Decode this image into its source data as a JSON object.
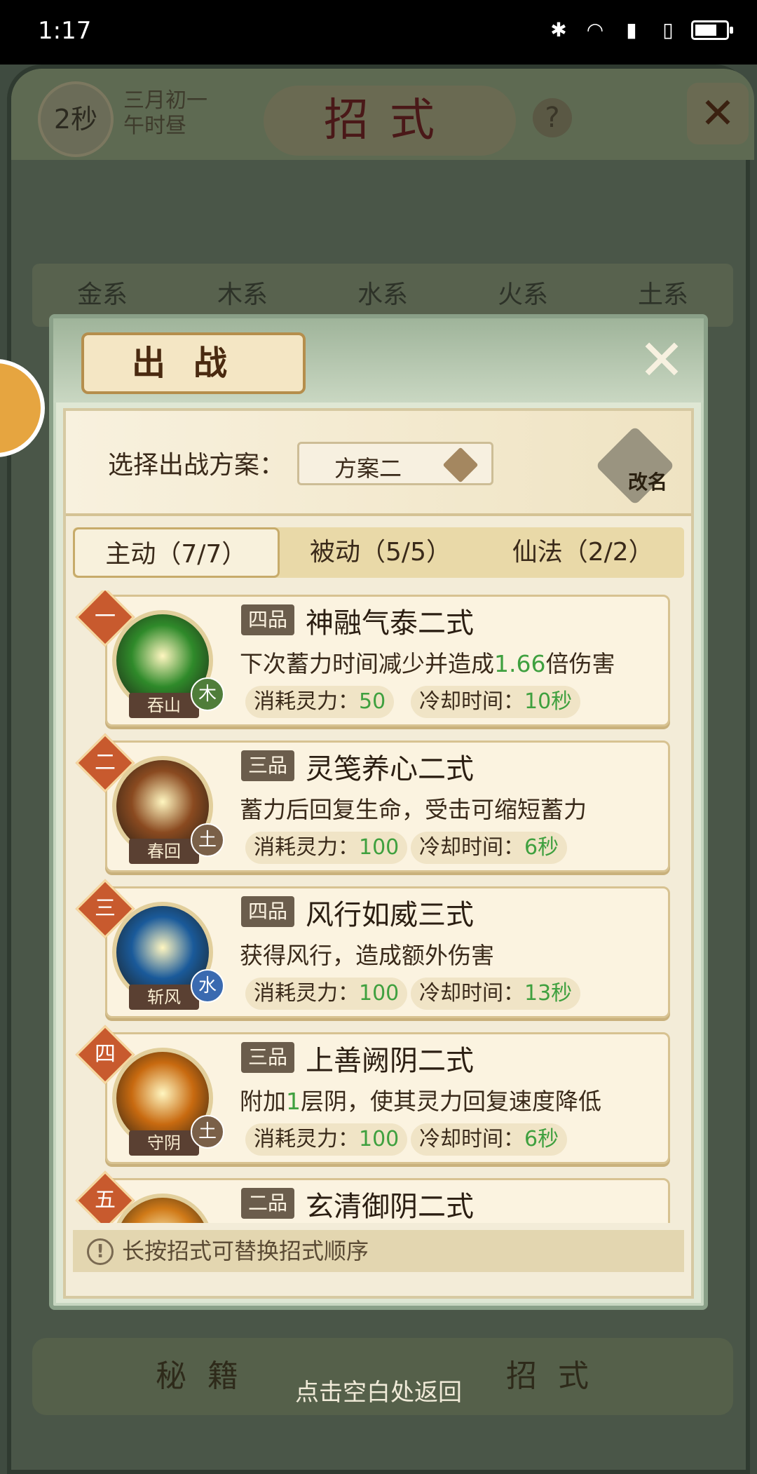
{
  "status_bar": {
    "time": "1:17",
    "icons": [
      "bluetooth-icon",
      "wifi-icon",
      "signal-4g-icon",
      "signal-icon",
      "battery-icon"
    ]
  },
  "background": {
    "timer": "2秒",
    "date_line1": "三月初一",
    "date_line2": "午时昼",
    "title": "招式",
    "help": "?",
    "tabs": [
      "金系",
      "木系",
      "水系",
      "火系",
      "土系"
    ],
    "bottom_tabs": [
      "秘籍",
      "招式"
    ]
  },
  "popup": {
    "title": "出战",
    "scheme_label": "选择出战方案：",
    "scheme_value": "方案二",
    "rename_label": "改名",
    "subtabs": [
      "主动（7/7）",
      "被动（5/5）",
      "仙法（2/2）"
    ],
    "skills": [
      {
        "rank": "一",
        "grade": "四品",
        "name": "神融气泰二式",
        "desc_pre": "下次蓄力时间减少并造成",
        "desc_hl": "1.66",
        "desc_post": "倍伤害",
        "cost_label": "消耗灵力：",
        "cost": "50",
        "cd_label": "冷却时间：",
        "cd": "10秒",
        "icon_name": "吞山",
        "element": "木",
        "element_color": "#4f7d3a",
        "orb_color": "#2f8a2a"
      },
      {
        "rank": "二",
        "grade": "三品",
        "name": "灵笺养心二式",
        "desc_pre": "蓄力后回复生命，受击可缩短蓄力",
        "desc_hl": "",
        "desc_post": "",
        "cost_label": "消耗灵力：",
        "cost": "100",
        "cd_label": "冷却时间：",
        "cd": "6秒",
        "icon_name": "春回",
        "element": "土",
        "element_color": "#7a6048",
        "orb_color": "#8a4a20"
      },
      {
        "rank": "三",
        "grade": "四品",
        "name": "风行如威三式",
        "desc_pre": "获得风行，造成额外伤害",
        "desc_hl": "",
        "desc_post": "",
        "cost_label": "消耗灵力：",
        "cost": "100",
        "cd_label": "冷却时间：",
        "cd": "13秒",
        "icon_name": "斩风",
        "element": "水",
        "element_color": "#3a6ab0",
        "orb_color": "#1a5a9a"
      },
      {
        "rank": "四",
        "grade": "三品",
        "name": "上善阙阴二式",
        "desc_pre": "附加",
        "desc_hl": "1",
        "desc_post": "层阴，使其灵力回复速度降低",
        "cost_label": "消耗灵力：",
        "cost": "100",
        "cd_label": "冷却时间：",
        "cd": "6秒",
        "icon_name": "守阴",
        "element": "土",
        "element_color": "#7a6048",
        "orb_color": "#c86a10"
      },
      {
        "rank": "五",
        "grade": "二品",
        "name": "玄清御阴二式",
        "desc_pre": "",
        "desc_hl": "",
        "desc_post": "",
        "cost_label": "",
        "cost": "",
        "cd_label": "",
        "cd": "",
        "icon_name": "",
        "element": "",
        "element_color": "#7a6048",
        "orb_color": "#d07a18"
      }
    ],
    "tip": "长按招式可替换招式顺序"
  },
  "tap_hint": "点击空白处返回"
}
